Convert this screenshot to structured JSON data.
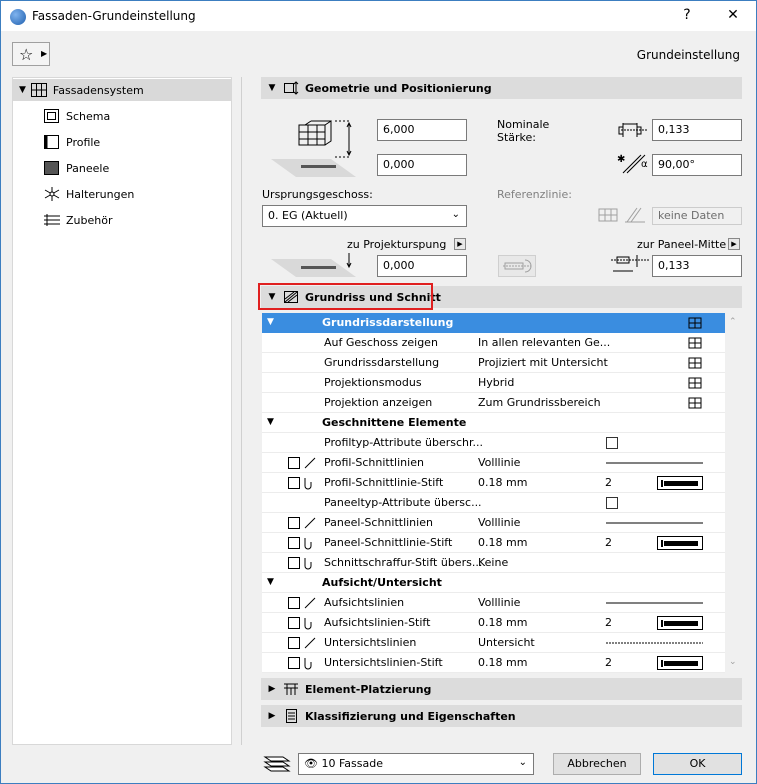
{
  "window": {
    "title": "Fassaden-Grundeinstellung",
    "help_label": "?",
    "close_label": "✕"
  },
  "top": {
    "right_label": "Grundeinstellung"
  },
  "sidebar": {
    "items": [
      {
        "label": "Fassadensystem"
      },
      {
        "label": "Schema"
      },
      {
        "label": "Profile"
      },
      {
        "label": "Paneele"
      },
      {
        "label": "Halterungen"
      },
      {
        "label": "Zubehör"
      }
    ]
  },
  "geometry": {
    "title": "Geometrie und Positionierung",
    "height_value": "6,000",
    "offset_value": "0,000",
    "nominal_label": "Nominale\nStärke:",
    "nominal_value": "0,133",
    "angle_value": "90,00°",
    "origin_story_label": "Ursprungsgeschoss:",
    "origin_story_value": "0. EG (Aktuell)",
    "ref_line_label": "Referenzlinie:",
    "ref_line_value": "keine Daten",
    "project_origin_label": "zu Projekturspung",
    "project_origin_value": "0,000",
    "panel_middle_label": "zur Paneel-Mitte",
    "panel_middle_value": "0,133"
  },
  "floorplan": {
    "title": "Grundriss und Schnitt",
    "rows": [
      {
        "type": "hdr",
        "name": "Grundrissdarstellung"
      },
      {
        "type": "item",
        "name": "Auf Geschoss zeigen",
        "value": "In allen relevanten Ge..."
      },
      {
        "type": "item",
        "name": "Grundrissdarstellung",
        "value": "Projiziert mit Untersicht"
      },
      {
        "type": "item",
        "name": "Projektionsmodus",
        "value": "Hybrid"
      },
      {
        "type": "item",
        "name": "Projektion anzeigen",
        "value": "Zum Grundrissbereich"
      },
      {
        "type": "grp",
        "name": "Geschnittene Elemente"
      },
      {
        "type": "item",
        "name": "Profiltyp-Attribute überschr...",
        "value": ""
      },
      {
        "type": "item",
        "name": "Profil-Schnittlinien",
        "value": "Volllinie"
      },
      {
        "type": "item",
        "name": "Profil-Schnittlinie-Stift",
        "value": "0.18 mm",
        "num": "2"
      },
      {
        "type": "item",
        "name": "Paneeltyp-Attribute übersc...",
        "value": ""
      },
      {
        "type": "item",
        "name": "Paneel-Schnittlinien",
        "value": "Volllinie"
      },
      {
        "type": "item",
        "name": "Paneel-Schnittlinie-Stift",
        "value": "0.18 mm",
        "num": "2"
      },
      {
        "type": "item",
        "name": "Schnittschraffur-Stift übers...",
        "value": "Keine"
      },
      {
        "type": "grp",
        "name": "Aufsicht/Untersicht"
      },
      {
        "type": "item",
        "name": "Aufsichtslinien",
        "value": "Volllinie"
      },
      {
        "type": "item",
        "name": "Aufsichtslinien-Stift",
        "value": "0.18 mm",
        "num": "2"
      },
      {
        "type": "item",
        "name": "Untersichtslinien",
        "value": "Untersicht"
      },
      {
        "type": "item",
        "name": "Untersichtslinien-Stift",
        "value": "0.18 mm",
        "num": "2"
      }
    ]
  },
  "sections": {
    "placement": "Element-Platzierung",
    "classification": "Klassifizierung und Eigenschaften"
  },
  "footer": {
    "layer_value": "10 Fassade",
    "cancel_label": "Abbrechen",
    "ok_label": "OK"
  }
}
